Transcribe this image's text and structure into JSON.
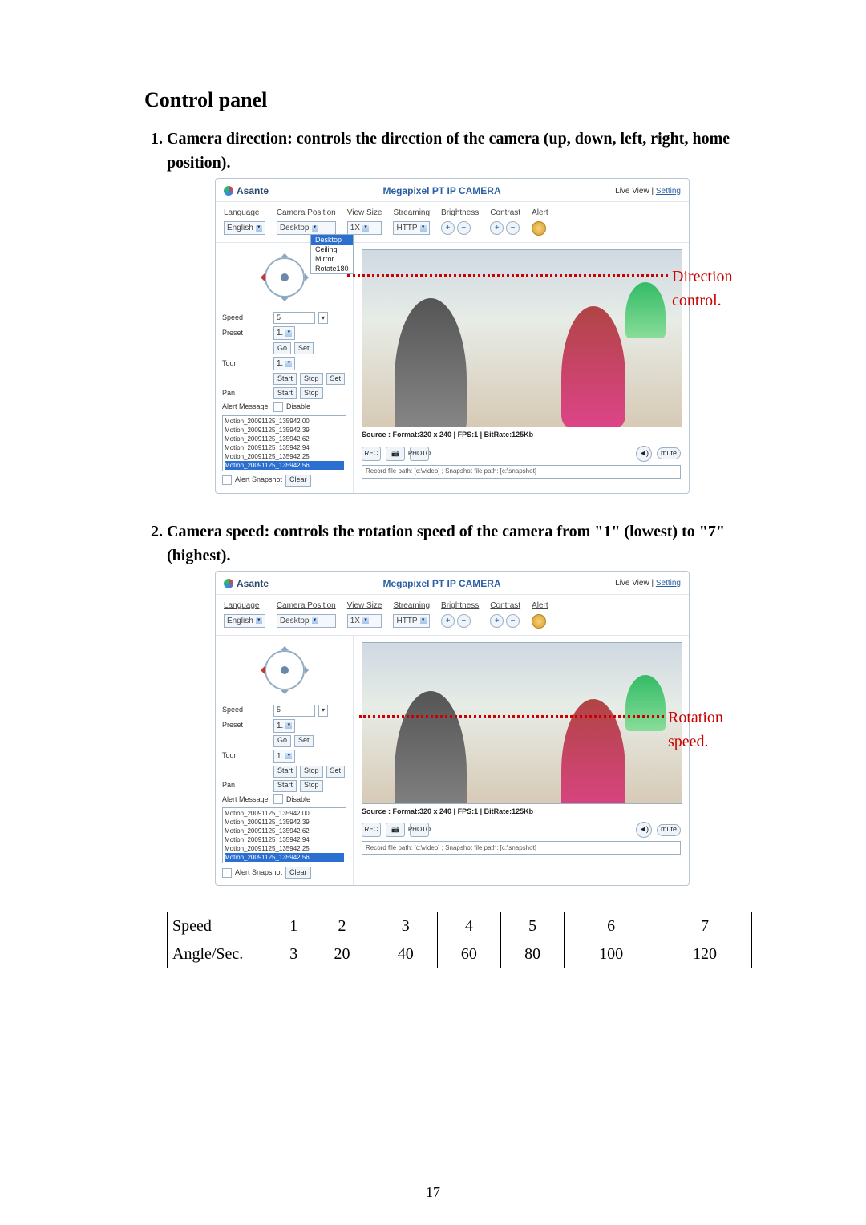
{
  "pageNumber": "17",
  "heading": "Control panel",
  "item1": "Camera direction: controls the direction of the camera (up, down, left, right, home position).",
  "item2": "Camera speed: controls the rotation speed of the camera from \"1\" (lowest) to \"7\" (highest).",
  "anno1": "Direction control.",
  "anno2": "Rotation speed.",
  "cam": {
    "brand": "Asante",
    "title": "Megapixel PT IP CAMERA",
    "liveview": "Live View",
    "setting": "Setting",
    "bar": {
      "language": "Language",
      "languageVal": "English",
      "camerapos": "Camera Position",
      "cameraposVal": "Desktop",
      "viewsize": "View Size",
      "viewsizeVal": "1X",
      "streaming": "Streaming",
      "streamingVal": "HTTP",
      "brightness": "Brightness",
      "contrast": "Contrast",
      "alert": "Alert"
    },
    "dd": {
      "a": "Desktop",
      "b": "Ceiling",
      "c": "Mirror",
      "d": "Rotate180"
    },
    "side": {
      "speed": "Speed",
      "speedVal": "5",
      "preset": "Preset",
      "presetVal": "1.",
      "go": "Go",
      "set": "Set",
      "tour": "Tour",
      "tourVal": "1.",
      "start": "Start",
      "stop": "Stop",
      "set2": "Set",
      "pan": "Pan",
      "alertmsg": "Alert Message",
      "disable": "Disable",
      "msgs": [
        "Motion_20091125_135942.00",
        "Motion_20091125_135942.39",
        "Motion_20091125_135942.62",
        "Motion_20091125_135942.94",
        "Motion_20091125_135942.25",
        "Motion_20091125_135942.56"
      ],
      "alertsnap": "Alert Snapshot",
      "clear": "Clear"
    },
    "src": "Source : Format:320 x 240 | FPS:1 | BitRate:125Kb",
    "path": "Record file path: [c:\\video] ; Snapshot file path: [c:\\snapshot]",
    "rec": "REC",
    "photo": "PHOTO",
    "sound": "◄)",
    "mute": "mute"
  },
  "chart_data": {
    "type": "table",
    "title": "",
    "rows": [
      {
        "label": "Speed",
        "values": [
          "1",
          "2",
          "3",
          "4",
          "5",
          "6",
          "7"
        ]
      },
      {
        "label": "Angle/Sec.",
        "values": [
          "3",
          "20",
          "40",
          "60",
          "80",
          "100",
          "120"
        ]
      }
    ]
  }
}
